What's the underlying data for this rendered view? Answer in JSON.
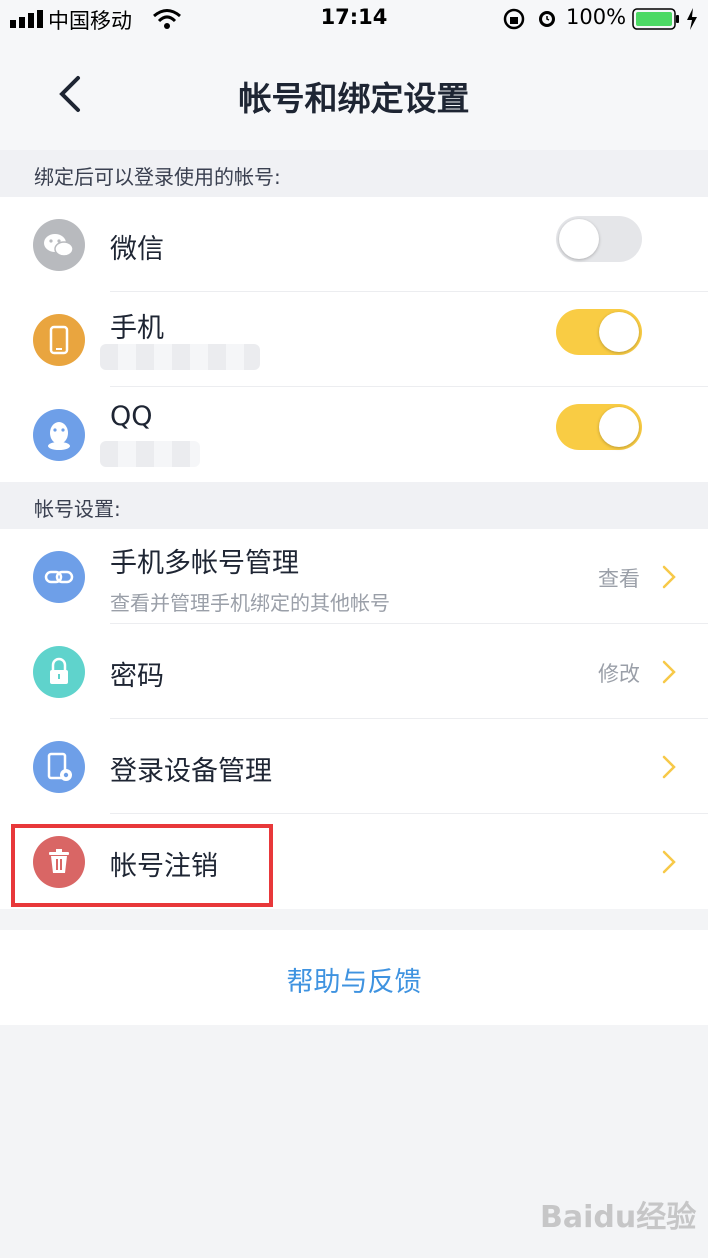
{
  "status_bar": {
    "carrier": "中国移动",
    "time": "17:14",
    "battery": "100%"
  },
  "header": {
    "title": "帐号和绑定设置"
  },
  "bound_accounts": {
    "section_label": "绑定后可以登录使用的帐号:",
    "items": [
      {
        "label": "微信",
        "icon": "wechat-icon",
        "toggle": "off",
        "icon_color": "#B8BABE"
      },
      {
        "label": "手机",
        "icon": "phone-icon",
        "toggle": "on",
        "icon_color": "#E9A53F"
      },
      {
        "label": "QQ",
        "icon": "qq-icon",
        "toggle": "on",
        "icon_color": "#6E9FE8"
      }
    ]
  },
  "account_settings": {
    "section_label": "帐号设置:",
    "items": [
      {
        "label": "手机多帐号管理",
        "subtitle": "查看并管理手机绑定的其他帐号",
        "action": "查看",
        "icon": "link-icon",
        "icon_color": "#6E9FE8"
      },
      {
        "label": "密码",
        "action": "修改",
        "icon": "lock-icon",
        "icon_color": "#5FD3CC"
      },
      {
        "label": "登录设备管理",
        "icon": "device-settings-icon",
        "icon_color": "#6E9FE8"
      },
      {
        "label": "帐号注销",
        "icon": "trash-icon",
        "icon_color": "#D96665"
      }
    ]
  },
  "help_link": "帮助与反馈",
  "watermark": "Baidu经验",
  "colors": {
    "accent_toggle": "#F9CC44",
    "chevron": "#F7C948",
    "link": "#3F93E0",
    "highlight": "#E8383A"
  }
}
